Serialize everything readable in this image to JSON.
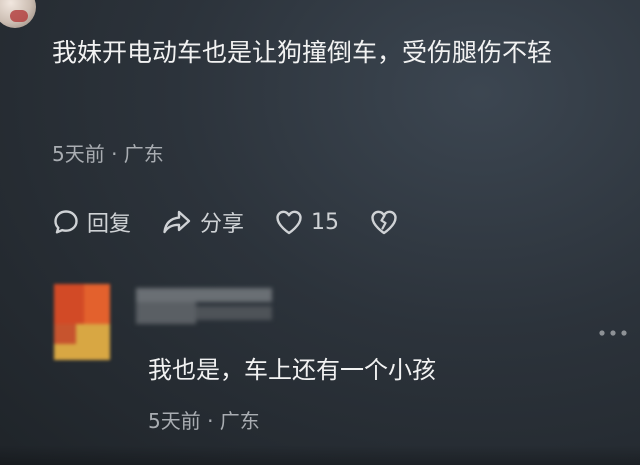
{
  "top_comment": {
    "text": "我妹开电动车也是让狗撞倒车，受伤腿伤不轻",
    "meta": "5天前 · 广东",
    "actions": {
      "reply_label": "回复",
      "share_label": "分享",
      "like_count": "15"
    }
  },
  "reply": {
    "text": "我也是，车上还有一个小孩",
    "meta": "5天前 · 广东"
  },
  "icons": [
    "reply-icon",
    "share-icon",
    "heart-icon",
    "dislike-broken-heart-icon",
    "more-dots-icon"
  ]
}
